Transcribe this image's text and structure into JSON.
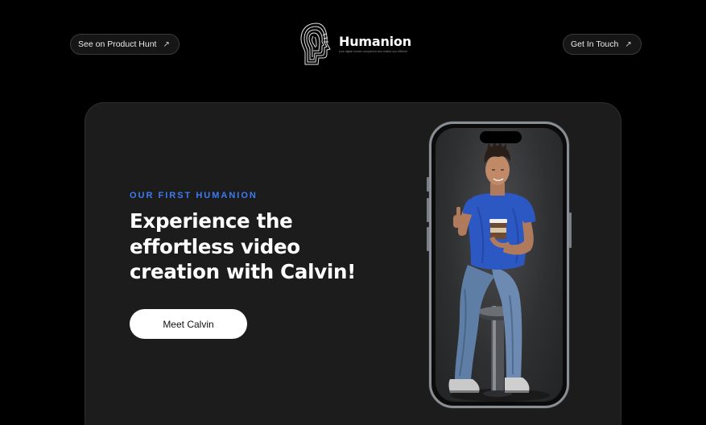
{
  "header": {
    "left_pill": {
      "label": "See on Product Hunt",
      "icon": "arrow-up-right-icon"
    },
    "right_pill": {
      "label": "Get In Touch",
      "icon": "arrow-up-right-icon"
    },
    "logo": {
      "brand": "Humanion",
      "tagline": "your digital human companion who makes you efficient"
    }
  },
  "hero": {
    "eyebrow": "OUR FIRST HUMANION",
    "headline": "Experience the effortless video creation with Calvin!",
    "cta_label": "Meet Calvin"
  },
  "colors": {
    "accent": "#3d7bf2",
    "background": "#000000",
    "card": "#1c1c1c"
  }
}
